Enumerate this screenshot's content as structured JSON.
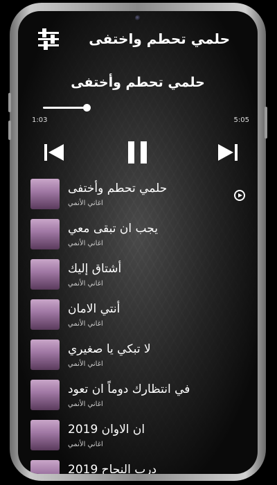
{
  "header": {
    "title": "حلمي تحطم واختفى",
    "settings_icon": "sliders-icon"
  },
  "player": {
    "now_playing": "حلمي تحطم وأختفى",
    "elapsed": "1:03",
    "duration": "5:05",
    "progress": 0.21,
    "prev_icon": "skip-previous-icon",
    "pause_icon": "pause-icon",
    "next_icon": "skip-next-icon"
  },
  "songs": [
    {
      "title": "حلمي تحطم وأختفى",
      "artist": "اغاني الأنمي",
      "now_playing_icon": "play-circle-icon"
    },
    {
      "title": "يجب ان تبقى معي",
      "artist": "اغاني الأنمي"
    },
    {
      "title": "أشتاق إليك",
      "artist": "اغاني الأنمي"
    },
    {
      "title": "أنتي الامان",
      "artist": "اغاني الأنمي"
    },
    {
      "title": "لا تبكي يا صغيري",
      "artist": "اغاني الأنمي"
    },
    {
      "title": "في انتظارك دوماً ان تعود",
      "artist": "اغاني الأنمي"
    },
    {
      "title": "ان الاوان 2019",
      "artist": "اغاني الأنمي"
    },
    {
      "title": "درب النجاح 2019",
      "artist": ""
    }
  ]
}
